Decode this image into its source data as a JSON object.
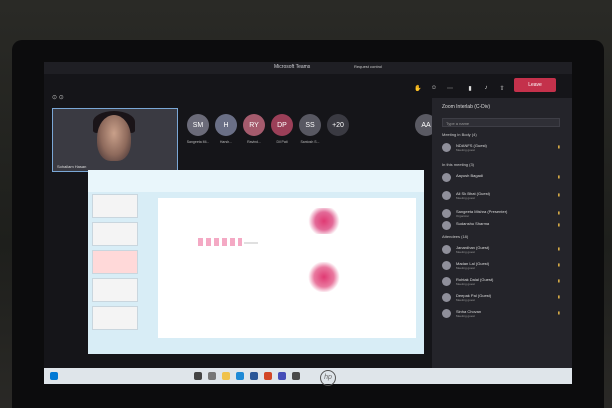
{
  "window": {
    "title": "Microsoft Teams",
    "suggestion": "Request control"
  },
  "controls": {
    "leave_label": "Leave",
    "timer": ""
  },
  "self_tile": {
    "name": "Sohailam Hasan"
  },
  "avatars": [
    {
      "initials": "SM",
      "color": "#6b6b79",
      "sub": "Sangeeta Mi..."
    },
    {
      "initials": "H",
      "color": "#6a6f86",
      "sub": "Harsh..."
    },
    {
      "initials": "RY",
      "color": "#a55b6d",
      "sub": "Ravind..."
    },
    {
      "initials": "DP",
      "color": "#9b3f58",
      "sub": "Dil Pati"
    },
    {
      "initials": "SS",
      "color": "#585862",
      "sub": "Santosh S..."
    },
    {
      "initials": "+20",
      "color": "#3a3a42",
      "sub": ""
    },
    {
      "initials": "AA",
      "color": "#5a5a63",
      "sub": ""
    }
  ],
  "panel": {
    "title": "Zoom Interlab (C-Div)",
    "search_placeholder": "Type a name",
    "sections": [
      "Meeting in Body (4)",
      "In this meeting (3)",
      "Attendees (18)"
    ],
    "participants": [
      {
        "name": "NDANFS (Guest)",
        "role": "Meeting guest"
      },
      {
        "name": "Aayush Bagadi",
        "role": ""
      },
      {
        "name": "Ali Sk Bhat (Guest)",
        "role": "Meeting guest"
      },
      {
        "name": "Sangeeta Mishra (Presenter)",
        "role": "Organizer"
      },
      {
        "name": "Sudanshu Sharma",
        "role": ""
      },
      {
        "name": "Janardhan (Guest)",
        "role": "Meeting guest"
      },
      {
        "name": "Madan Lal (Guest)",
        "role": "Meeting guest"
      },
      {
        "name": "Rohtak Dalal (Guest)",
        "role": "Meeting guest"
      },
      {
        "name": "Deepak Pal (Guest)",
        "role": "Meeting guest"
      },
      {
        "name": "Sinha Chovan",
        "role": "Meeting guest"
      }
    ]
  },
  "taskbar": {
    "time": ""
  }
}
